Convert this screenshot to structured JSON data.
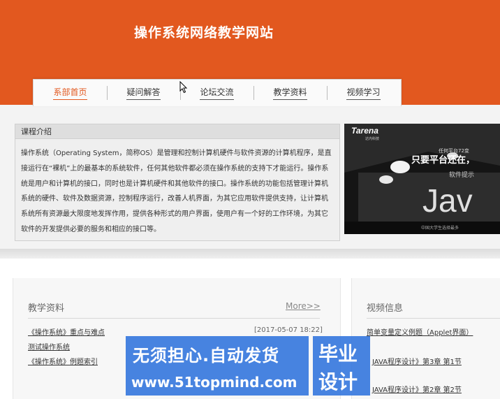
{
  "header": {
    "site_title": "操作系统网络教学网站"
  },
  "nav": {
    "items": [
      {
        "label": "系部首页",
        "active": true
      },
      {
        "label": "疑问解答"
      },
      {
        "label": "论坛交流"
      },
      {
        "label": "教学资料"
      },
      {
        "label": "视频学习"
      }
    ]
  },
  "intro": {
    "title": "课程介绍",
    "body": "操作系统（Operating System，简称OS）是管理和控制计算机硬件与软件资源的计算机程序，是直接运行在“裸机”上的最基本的系统软件，任何其他软件都必须在操作系统的支持下才能运行。操作系统是用户和计算机的接口，同时也是计算机硬件和其他软件的接口。操作系统的功能包括管理计算机系统的硬件、软件及数据资源，控制程序运行，改善人机界面，为其它应用软件提供支持，让计算机系统所有资源最大限度地发挥作用，提供各种形式的用户界面，使用户有一个好的工作环境，为其它软件的开发提供必要的服务和相应的接口等。"
  },
  "banner": {
    "brand": "Tarena",
    "brand_sub": "达内科技",
    "line1": "任何平台72变",
    "line2": "只要平台还在，",
    "line3": "软件提示",
    "big_text": "Jav",
    "footer": "中国大学生选择最多"
  },
  "materials": {
    "title": "教学资料",
    "more": "More>>",
    "items": [
      {
        "title": "《操作系统》重点与难点",
        "date": "[2017-05-07 18:22]"
      },
      {
        "title": "测试操作系统",
        "date": ""
      },
      {
        "title": "《操作系统》例题索引",
        "date": ""
      }
    ]
  },
  "videos": {
    "title": "视频信息",
    "items": [
      {
        "title": "简单变量定义例题（Applet界面）"
      },
      {
        "title": "JAVA程序设计》第3章 第1节"
      },
      {
        "title": "JAVA程序设计》第2章 第2节"
      }
    ]
  },
  "watermark": {
    "line1": "无须担心.自动发货",
    "line2": "www.51topmind.com",
    "right1": "毕业",
    "right2": "设计"
  },
  "colors": {
    "accent": "#e2581f",
    "watermark": "#286edc"
  }
}
